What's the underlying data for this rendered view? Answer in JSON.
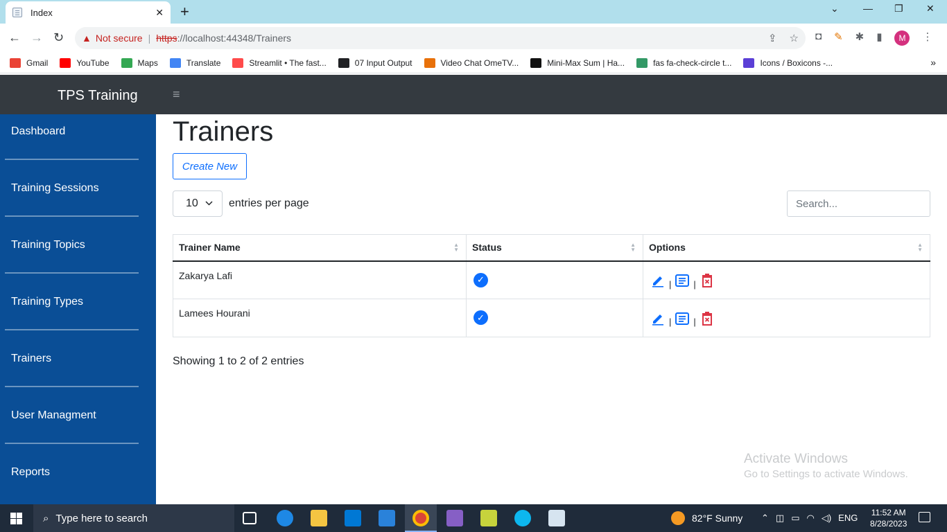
{
  "browser": {
    "tab_title": "Index",
    "new_tab": "+",
    "url_warning": "Not secure",
    "url_scheme": "https",
    "url_rest": "://localhost:44348/Trainers",
    "profile_initial": "M",
    "bookmarks": [
      {
        "label": "Gmail",
        "color": "#ea4335"
      },
      {
        "label": "YouTube",
        "color": "#ff0000"
      },
      {
        "label": "Maps",
        "color": "#34a853"
      },
      {
        "label": "Translate",
        "color": "#4285f4"
      },
      {
        "label": "Streamlit • The fast...",
        "color": "#ff4b4b"
      },
      {
        "label": "07 Input Output",
        "color": "#202124"
      },
      {
        "label": "Video Chat OmeTV...",
        "color": "#e8710a"
      },
      {
        "label": "Mini-Max Sum | Ha...",
        "color": "#111111"
      },
      {
        "label": "fas fa-check-circle t...",
        "color": "#339966"
      },
      {
        "label": "Icons / Boxicons -...",
        "color": "#5b3fd6"
      }
    ]
  },
  "app": {
    "brand": "TPS Training",
    "sidebar": [
      {
        "label": "Dashboard"
      },
      {
        "label": "Training Sessions"
      },
      {
        "label": "Training Topics"
      },
      {
        "label": "Training Types"
      },
      {
        "label": "Trainers"
      },
      {
        "label": "User Managment"
      },
      {
        "label": "Reports"
      }
    ],
    "page_title": "Trainers",
    "create_label": "Create New",
    "page_size": "10",
    "per_page_label": "entries per page",
    "search_placeholder": "Search...",
    "columns": [
      "Trainer Name",
      "Status",
      "Options"
    ],
    "rows": [
      {
        "name": "Zakarya Lafi",
        "status": "active"
      },
      {
        "name": "Lamees Hourani",
        "status": "active"
      }
    ],
    "option_separator": "|",
    "info": "Showing 1 to 2 of 2 entries",
    "accent_color": "#0d6efd",
    "delete_color": "#dc3545",
    "sidebar_color": "#0a4e96"
  },
  "watermark": {
    "line1": "Activate Windows",
    "line2": "Go to Settings to activate Windows."
  },
  "taskbar": {
    "search_placeholder": "Type here to search",
    "weather": "82°F  Sunny",
    "language": "ENG",
    "time": "11:52 AM",
    "date": "8/28/2023"
  }
}
